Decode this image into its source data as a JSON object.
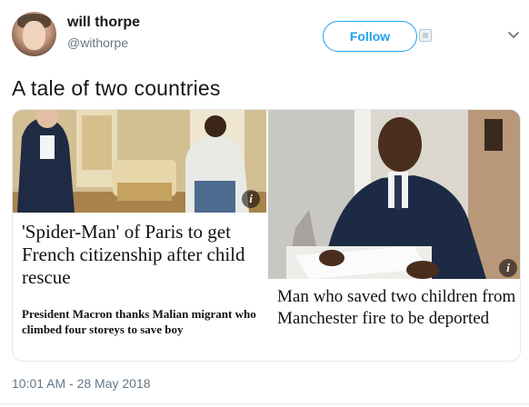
{
  "user": {
    "name": "will thorpe",
    "handle": "@withorpe"
  },
  "follow_button": {
    "label": "Follow"
  },
  "tweet": {
    "text": "A tale of two countries",
    "timestamp": "10:01 AM - 28 May 2018"
  },
  "media": [
    {
      "headline": "'Spider-Man' of Paris to get French citizenship after child rescue",
      "subheadline": "President Macron thanks Malian migrant who climbed four storeys to save boy",
      "badge": "i"
    },
    {
      "headline": "Man who saved two children from Manchester fire to be deported",
      "badge": "i"
    }
  ],
  "icons": {
    "menu": "chevron-down-icon",
    "follow_extra": "image-icon",
    "info": "info-icon"
  },
  "colors": {
    "accent": "#1da1f2",
    "secondary_text": "#657786"
  }
}
